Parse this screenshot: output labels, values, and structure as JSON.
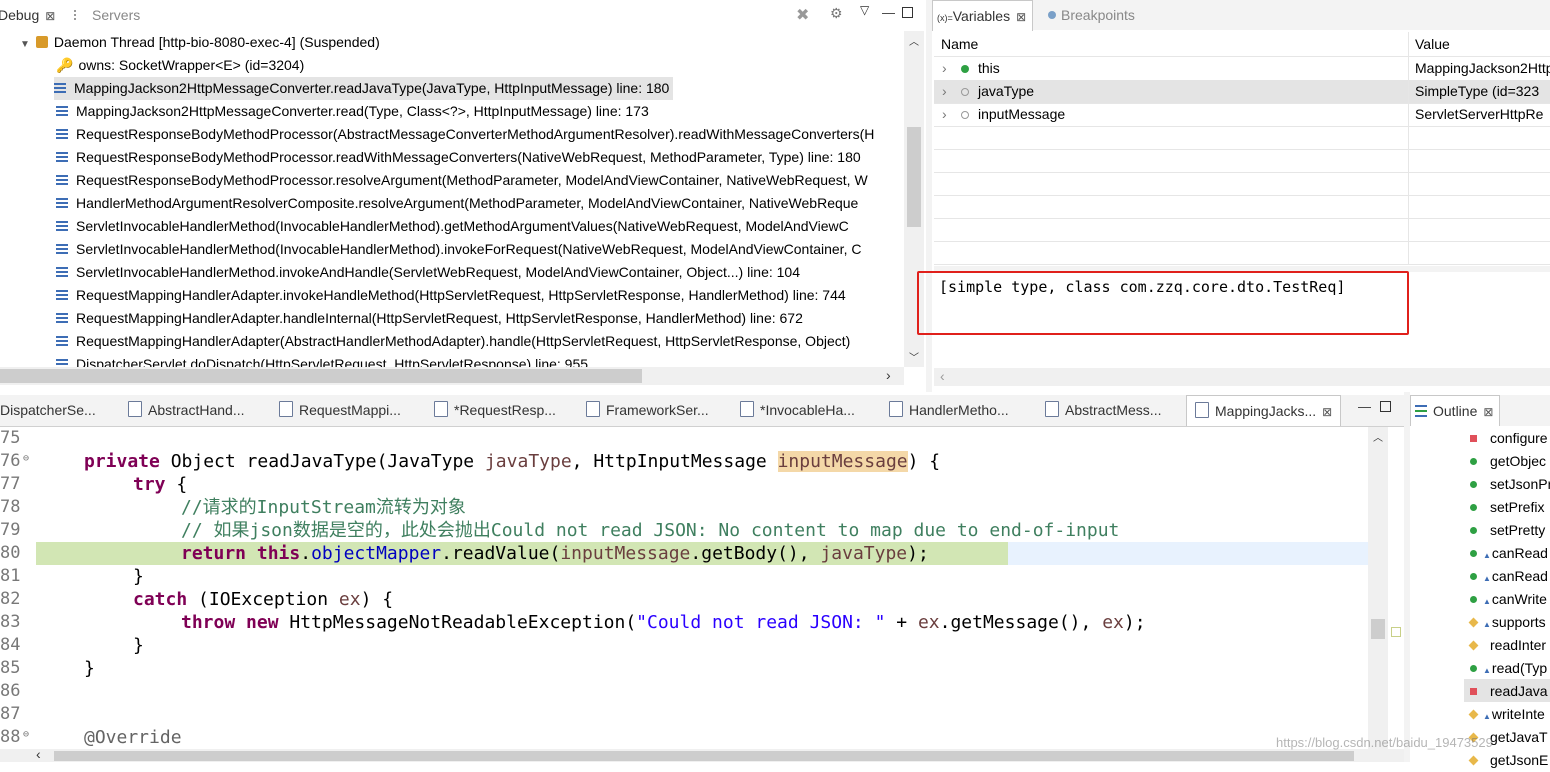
{
  "debug_view": {
    "tabs": [
      {
        "label": "Debug",
        "close": "⊠"
      },
      {
        "label": "Servers"
      }
    ],
    "thread": "Daemon Thread [http-bio-8080-exec-4] (Suspended)",
    "owns": "owns: SocketWrapper<E>  (id=3204)",
    "frames": [
      "MappingJackson2HttpMessageConverter.readJavaType(JavaType, HttpInputMessage) line: 180",
      "MappingJackson2HttpMessageConverter.read(Type, Class<?>, HttpInputMessage) line: 173",
      "RequestResponseBodyMethodProcessor(AbstractMessageConverterMethodArgumentResolver).readWithMessageConverters(H",
      "RequestResponseBodyMethodProcessor.readWithMessageConverters(NativeWebRequest, MethodParameter, Type) line: 180",
      "RequestResponseBodyMethodProcessor.resolveArgument(MethodParameter, ModelAndViewContainer, NativeWebRequest, W",
      "HandlerMethodArgumentResolverComposite.resolveArgument(MethodParameter, ModelAndViewContainer, NativeWebReque",
      "ServletInvocableHandlerMethod(InvocableHandlerMethod).getMethodArgumentValues(NativeWebRequest, ModelAndViewC",
      "ServletInvocableHandlerMethod(InvocableHandlerMethod).invokeForRequest(NativeWebRequest, ModelAndViewContainer, C",
      "ServletInvocableHandlerMethod.invokeAndHandle(ServletWebRequest, ModelAndViewContainer, Object...) line: 104",
      "RequestMappingHandlerAdapter.invokeHandleMethod(HttpServletRequest, HttpServletResponse, HandlerMethod) line: 744",
      "RequestMappingHandlerAdapter.handleInternal(HttpServletRequest, HttpServletResponse, HandlerMethod) line: 672",
      "RequestMappingHandlerAdapter(AbstractHandlerMethodAdapter).handle(HttpServletRequest, HttpServletResponse, Object)",
      "DispatcherServlet.doDispatch(HttpServletRequest, HttpServletResponse) line: 955"
    ]
  },
  "variables_view": {
    "tabs": [
      {
        "label": "Variables",
        "prefix": "(x)=",
        "close": "⊠"
      },
      {
        "label": "Breakpoints"
      }
    ],
    "columns": {
      "name": "Name",
      "value": "Value"
    },
    "rows": [
      {
        "name": "this",
        "value": "MappingJackson2Http",
        "dot": "#2ea043"
      },
      {
        "name": "javaType",
        "value": "SimpleType  (id=323",
        "dot": "#a0a0a0"
      },
      {
        "name": "inputMessage",
        "value": "ServletServerHttpRe",
        "dot": "#a0a0a0"
      }
    ],
    "detail": "[simple type, class com.zzq.core.dto.TestReq]",
    "highlight_color": "#e0201b"
  },
  "editor": {
    "tabs": [
      "DispatcherSe...",
      "AbstractHand...",
      "RequestMappi...",
      "*RequestResp...",
      "FrameworkSer...",
      "*InvocableHa...",
      "HandlerMetho...",
      "AbstractMess...",
      "MappingJacks..."
    ],
    "line_numbers": [
      "75",
      "76",
      "77",
      "78",
      "79",
      "80",
      "81",
      "82",
      "83",
      "84",
      "85",
      "86",
      "87",
      "88"
    ],
    "code": {
      "l76_kw": "private",
      "l76_a": " Object readJavaType(JavaType ",
      "l76_p1": "javaType",
      "l76_b": ", HttpInputMessage ",
      "l76_p2": "inputMessage",
      "l76_c": ") {",
      "l77_kw": "try",
      "l77_a": " {",
      "l78": "//请求的InputStream流转为对象",
      "l79": "// 如果json数据是空的，此处会抛出Could not read JSON: No content to map due to end-of-input",
      "l80_kw1": "return",
      "l80_kw2": "this",
      "l80_dot": ".",
      "l80_fld": "objectMapper",
      "l80_a": ".readValue(",
      "l80_p1": "inputMessage",
      "l80_b": ".getBody(), ",
      "l80_p2": "javaType",
      "l80_c": ");",
      "l81": "}",
      "l82_kw": "catch",
      "l82_a": " (IOException ",
      "l82_p": "ex",
      "l82_b": ") {",
      "l83_kw1": "throw",
      "l83_kw2": "new",
      "l83_a": " HttpMessageNotReadableException(",
      "l83_st": "\"Could not read JSON: \"",
      "l83_b": " + ",
      "l83_p1": "ex",
      "l83_c": ".getMessage(), ",
      "l83_p2": "ex",
      "l83_d": ");",
      "l84": "}",
      "l85": "}",
      "l88": "@Override"
    },
    "current_line_color": "#d2e6b4"
  },
  "outline_view": {
    "tab": {
      "label": "Outline",
      "close": "⊠"
    },
    "items": [
      {
        "label": "configure",
        "icon": "#e0505a"
      },
      {
        "label": "getObjec",
        "icon": "#2ea043"
      },
      {
        "label": "setJsonPr",
        "icon": "#2ea043"
      },
      {
        "label": "setPrefix",
        "icon": "#2ea043"
      },
      {
        "label": "setPretty",
        "icon": "#2ea043"
      },
      {
        "label": "canRead",
        "icon": "#2ea043"
      },
      {
        "label": "canRead",
        "icon": "#2ea043"
      },
      {
        "label": "canWrite",
        "icon": "#2ea043"
      },
      {
        "label": "supports",
        "icon": "#e8b84a"
      },
      {
        "label": "readInter",
        "icon": "#e8b84a"
      },
      {
        "label": "read(Typ",
        "icon": "#2ea043"
      },
      {
        "label": "readJava",
        "icon": "#e0505a"
      },
      {
        "label": "writeInte",
        "icon": "#e8b84a"
      },
      {
        "label": "getJavaT",
        "icon": "#e8b84a"
      },
      {
        "label": "getJsonE",
        "icon": "#e8b84a"
      }
    ]
  },
  "watermark": "https://blog.csdn.net/baidu_19473529"
}
